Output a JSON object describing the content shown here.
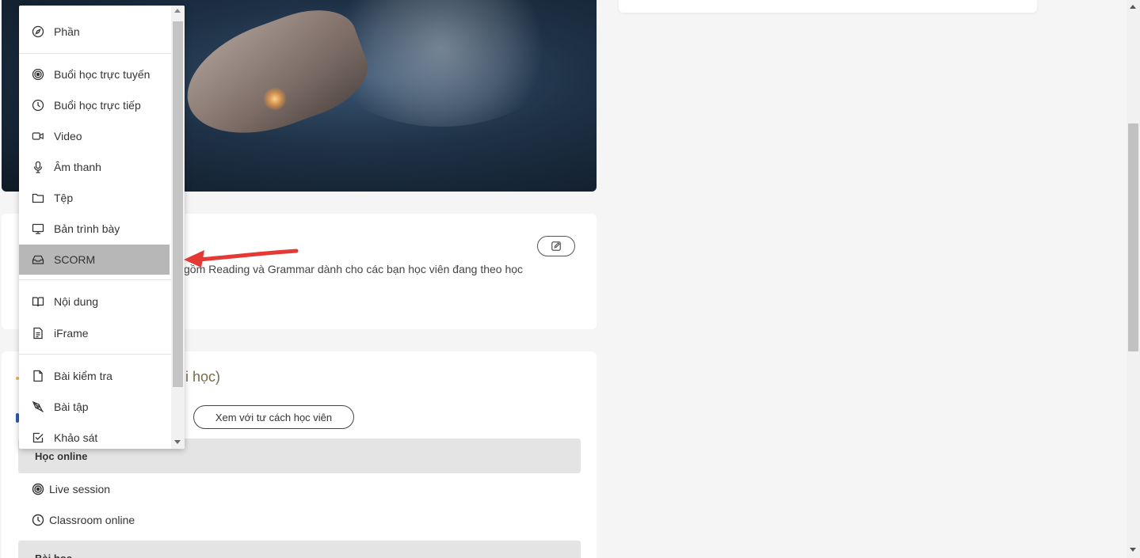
{
  "menu": {
    "items": [
      {
        "label": "Phần",
        "icon": "compass-icon"
      },
      {
        "label": "Buổi học trực tuyến",
        "icon": "target-icon"
      },
      {
        "label": "Buổi học trực tiếp",
        "icon": "clock-icon"
      },
      {
        "label": "Video",
        "icon": "video-icon"
      },
      {
        "label": "Âm thanh",
        "icon": "microphone-icon"
      },
      {
        "label": "Tệp",
        "icon": "folder-icon"
      },
      {
        "label": "Bản trình bày",
        "icon": "monitor-icon"
      },
      {
        "label": "SCORM",
        "icon": "inbox-icon",
        "selected": true
      },
      {
        "label": "Nội dung",
        "icon": "book-icon"
      },
      {
        "label": "iFrame",
        "icon": "document-icon"
      },
      {
        "label": "Bài kiểm tra",
        "icon": "file-icon"
      },
      {
        "label": "Bài tập",
        "icon": "pen-icon"
      },
      {
        "label": "Khảo sát",
        "icon": "checkbox-icon"
      }
    ]
  },
  "description": {
    "text": "gồm Reading và Grammar dành cho các bạn học viên đang theo học"
  },
  "content": {
    "title_fragment": "i học)",
    "student_view_label": "Xem với tư cách học viên",
    "sections": [
      {
        "title": "Học online"
      },
      {
        "title": "Bài học"
      }
    ],
    "lessons": [
      {
        "label": "Live session",
        "icon": "target-icon"
      },
      {
        "label": "Classroom online",
        "icon": "clock-icon"
      }
    ]
  },
  "colors": {
    "selected_bg": "#b7b7b7",
    "annotation_arrow": "#e53935",
    "section_bg": "#e4e4e4",
    "title_accent": "#7a6a4a"
  }
}
